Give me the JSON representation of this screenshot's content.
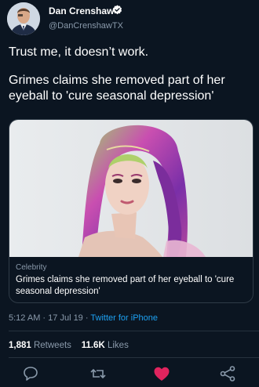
{
  "author": {
    "name": "Dan Crenshaw",
    "handle": "@DanCrenshawTX"
  },
  "tweet": {
    "text_line1": "Trust me, it doesn’t work.",
    "text_line2": " Grimes claims she removed part of her eyeball to 'cure seasonal depression'"
  },
  "card": {
    "source": "Celebrity",
    "title": "Grimes claims she removed part of her eyeball to 'cure seasonal depression'"
  },
  "meta": {
    "time": "5:12 AM",
    "date": "17 Jul 19",
    "separator": "·",
    "app": "Twitter for iPhone"
  },
  "stats": {
    "retweets_count": "1,881",
    "retweets_label": "Retweets",
    "likes_count": "11.6K",
    "likes_label": "Likes"
  },
  "icons": {
    "reply": "comment-icon",
    "retweet": "retweet-icon",
    "like": "heart-icon",
    "share": "share-icon"
  },
  "colors": {
    "background": "#0b1521",
    "accent": "#1da1f2",
    "liked": "#e0245e",
    "secondary_text": "#8a9aab"
  }
}
